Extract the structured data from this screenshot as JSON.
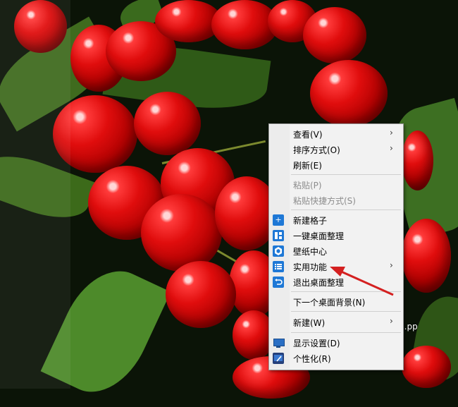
{
  "desktop": {
    "file_label_fragment": "2.pp"
  },
  "context_menu": {
    "items": [
      {
        "label": "查看(V)",
        "submenu": true,
        "enabled": true
      },
      {
        "label": "排序方式(O)",
        "submenu": true,
        "enabled": true
      },
      {
        "label": "刷新(E)",
        "submenu": false,
        "enabled": true
      },
      {
        "label": "粘贴(P)",
        "submenu": false,
        "enabled": false
      },
      {
        "label": "粘贴快捷方式(S)",
        "submenu": false,
        "enabled": false
      },
      {
        "label": "新建格子",
        "submenu": false,
        "enabled": true,
        "icon": "plus-icon"
      },
      {
        "label": "一键桌面整理",
        "submenu": false,
        "enabled": true,
        "icon": "grid-layout-icon"
      },
      {
        "label": "壁纸中心",
        "submenu": false,
        "enabled": true,
        "icon": "wallpaper-hexagon-icon"
      },
      {
        "label": "实用功能",
        "submenu": true,
        "enabled": true,
        "icon": "list-icon"
      },
      {
        "label": "退出桌面整理",
        "submenu": false,
        "enabled": true,
        "icon": "undo-exit-icon"
      },
      {
        "label": "下一个桌面背景(N)",
        "submenu": false,
        "enabled": true
      },
      {
        "label": "新建(W)",
        "submenu": true,
        "enabled": true
      },
      {
        "label": "显示设置(D)",
        "submenu": false,
        "enabled": true,
        "icon": "monitor-icon"
      },
      {
        "label": "个性化(R)",
        "submenu": false,
        "enabled": true,
        "icon": "personalize-icon"
      }
    ],
    "arrow_glyph": "›"
  },
  "colors": {
    "menu_background": "#f2f2f2",
    "icon_blue": "#1e78d6",
    "annotation_red": "#d42020"
  }
}
